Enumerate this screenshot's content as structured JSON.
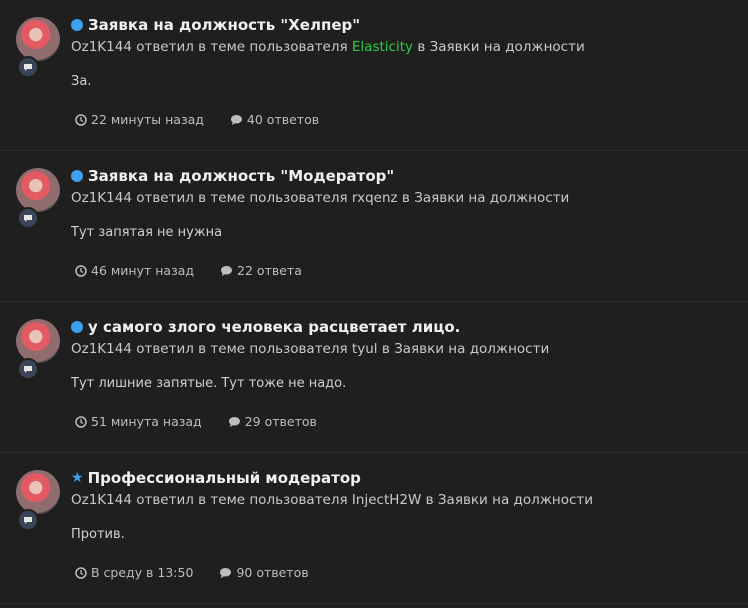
{
  "activity": [
    {
      "title": "Заявка на должность \"Хелпер\"",
      "marker": "dot",
      "user": "Oz1K144",
      "action": "ответил в теме пользователя",
      "topic_author": "Elasticity",
      "author_highlight": true,
      "in_text": "в",
      "forum": "Заявки на должности",
      "excerpt": "За.",
      "time": "22 минуты назад",
      "replies": "40 ответов"
    },
    {
      "title": "Заявка на должность \"Модератор\"",
      "marker": "dot",
      "user": "Oz1K144",
      "action": "ответил в теме пользователя",
      "topic_author": "rxqenz",
      "author_highlight": false,
      "in_text": "в",
      "forum": "Заявки на должности",
      "excerpt": "Тут запятая не нужна",
      "time": "46 минут назад",
      "replies": "22 ответа"
    },
    {
      "title": "у самого злого человека расцветает лицо.",
      "marker": "dot",
      "user": "Oz1K144",
      "action": "ответил в теме пользователя",
      "topic_author": "tyul",
      "author_highlight": false,
      "in_text": "в",
      "forum": "Заявки на должности",
      "excerpt": "Тут лишние запятые. Тут тоже не надо.",
      "time": "51 минута назад",
      "replies": "29 ответов"
    },
    {
      "title": "Профессиональный модератор",
      "marker": "star",
      "user": "Oz1K144",
      "action": "ответил в теме пользователя",
      "topic_author": "InjectH2W",
      "author_highlight": false,
      "in_text": "в",
      "forum": "Заявки на должности",
      "excerpt": "Против.",
      "time": "В среду в 13:50",
      "replies": "90 ответов"
    }
  ],
  "colors": {
    "accent": "#3da0ee",
    "highlight_user": "#2ecc40",
    "background": "#1f1f1f"
  },
  "icons": {
    "unread": "unread-dot-icon",
    "featured": "star-icon",
    "time": "clock-icon",
    "replies": "speech-bubble-icon",
    "badge": "comment-badge-icon"
  }
}
